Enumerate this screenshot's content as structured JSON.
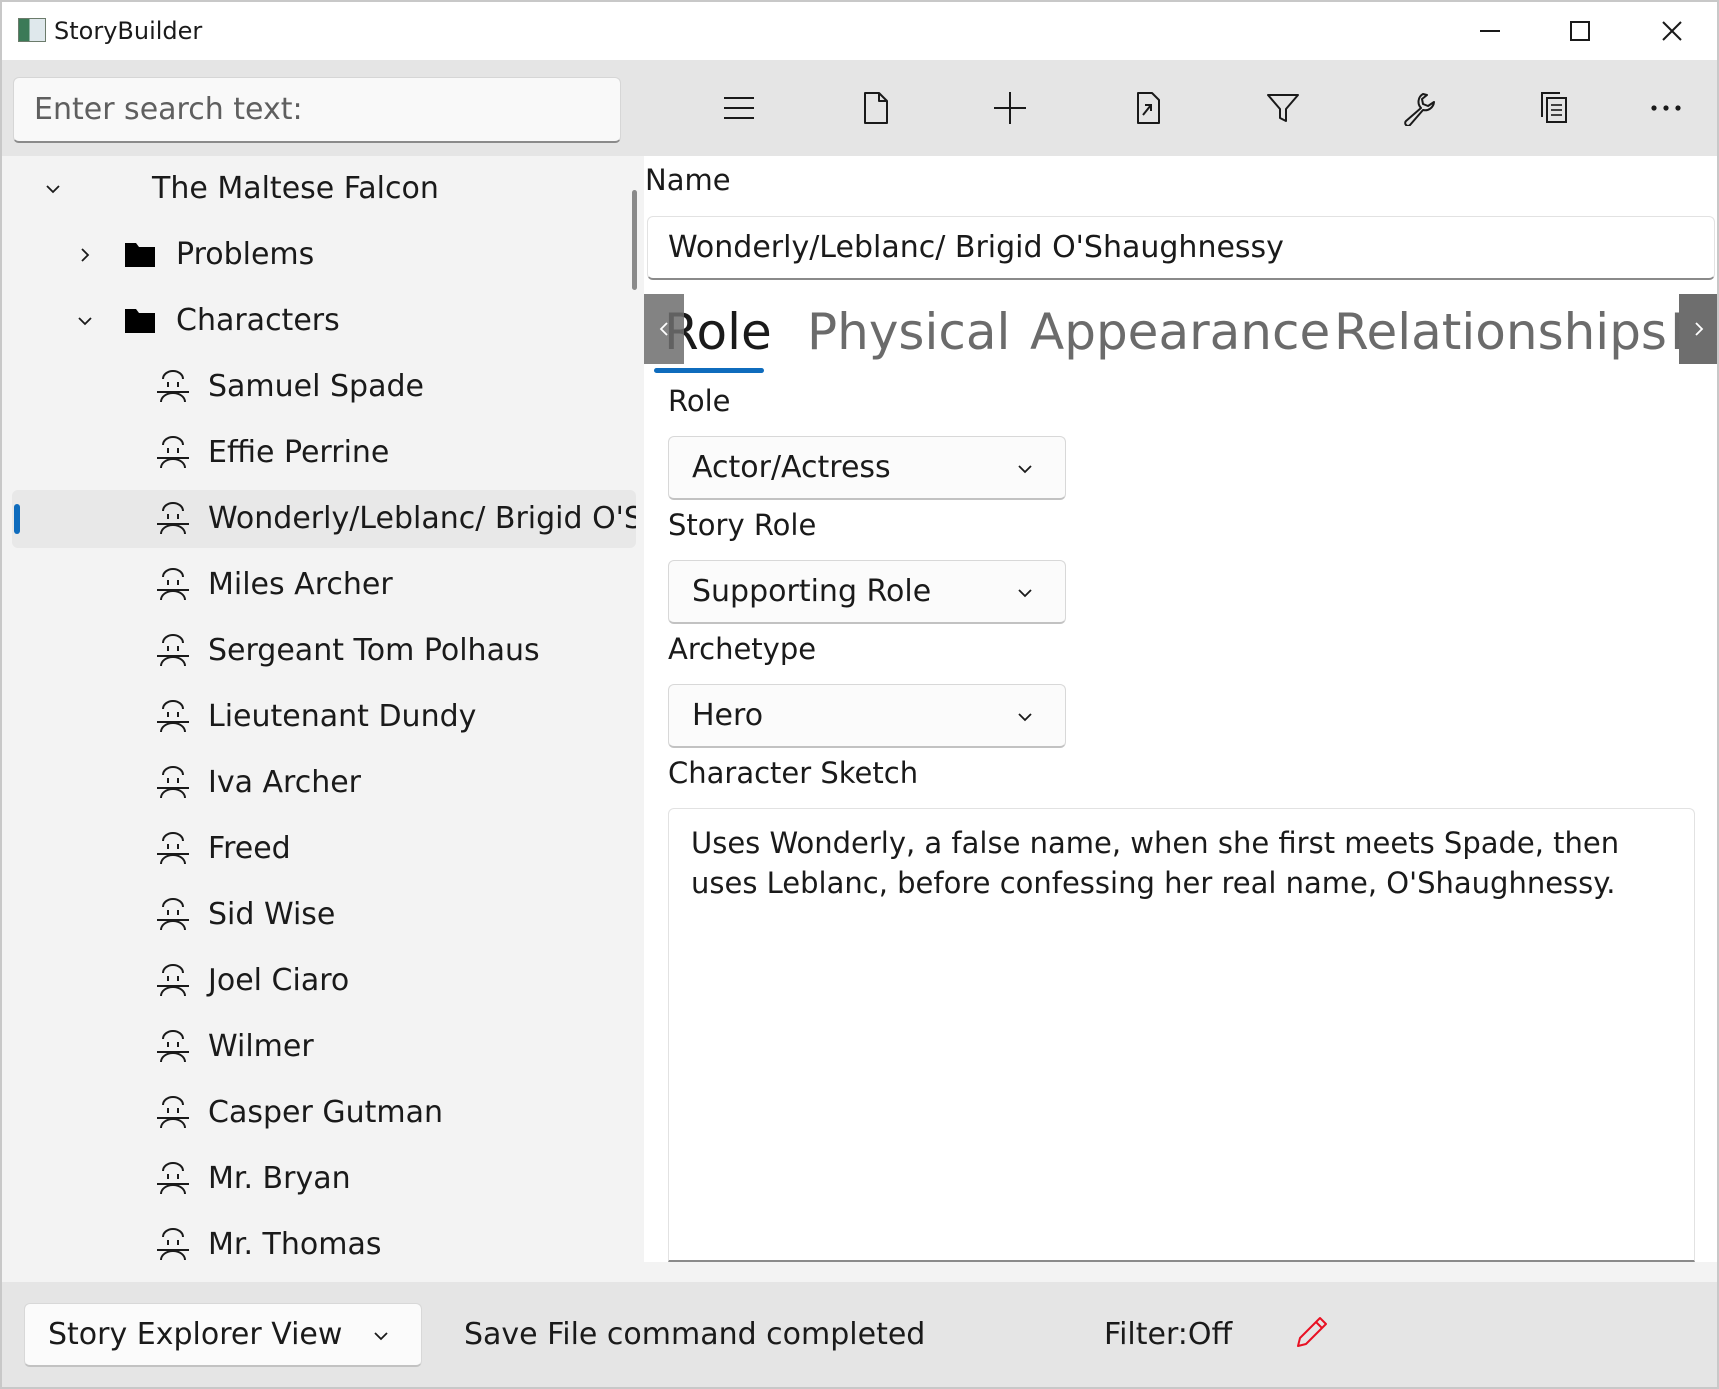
{
  "window": {
    "title": "StoryBuilder"
  },
  "toolbar": {
    "search_placeholder": "Enter search text:",
    "buttons": [
      {
        "name": "menu-icon"
      },
      {
        "name": "new-file-icon"
      },
      {
        "name": "add-icon"
      },
      {
        "name": "move-out-icon"
      },
      {
        "name": "filter-icon"
      },
      {
        "name": "tools-icon"
      },
      {
        "name": "copy-icon"
      },
      {
        "name": "more-icon"
      }
    ]
  },
  "tree": {
    "root": "The Maltese Falcon",
    "folders": [
      "Problems",
      "Characters"
    ],
    "characters": [
      "Samuel Spade",
      "Effie Perrine",
      "Wonderly/Leblanc/ Brigid O'Shaughnessy",
      "Miles Archer",
      "Sergeant Tom Polhaus",
      "Lieutenant Dundy",
      "Iva Archer",
      "Freed",
      "Sid Wise",
      "Joel Ciaro",
      "Wilmer",
      "Casper Gutman",
      "Mr. Bryan",
      "Mr. Thomas"
    ],
    "selected_index": 2
  },
  "detail": {
    "name_label": "Name",
    "name_value": "Wonderly/Leblanc/ Brigid O'Shaughnessy",
    "tabs": [
      "Role",
      "Physical",
      "Appearance",
      "Relationships",
      "Fla"
    ],
    "active_tab": "Role",
    "role_label": "Role",
    "role_value": "Actor/Actress",
    "story_role_label": "Story Role",
    "story_role_value": "Supporting Role",
    "archetype_label": "Archetype",
    "archetype_value": "Hero",
    "sketch_label": "Character Sketch",
    "sketch_text": "Uses Wonderly, a false name, when she first meets Spade, then uses Leblanc, before confessing her real name, O'Shaughnessy."
  },
  "statusbar": {
    "view_value": "Story Explorer View",
    "message": "Save File command completed",
    "filter": "Filter:Off"
  },
  "colors": {
    "accent": "#0f6cbd",
    "edit_pencil": "#e81123",
    "toolbar_bg": "#e5e5e5",
    "tree_bg": "#f3f3f3"
  }
}
